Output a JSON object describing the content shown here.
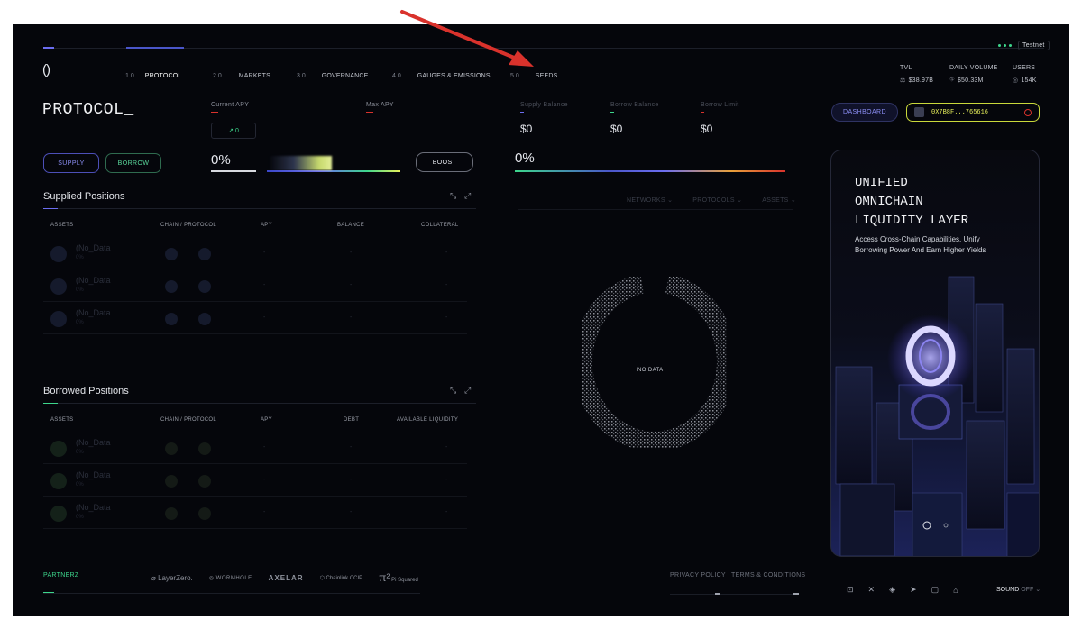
{
  "network_label": "Testnet",
  "nav": [
    {
      "num": "1.0",
      "label": "PROTOCOL"
    },
    {
      "num": "2.0",
      "label": "MARKETS"
    },
    {
      "num": "3.0",
      "label": "GOVERNANCE"
    },
    {
      "num": "4.0",
      "label": "GAUGES & EMISSIONS"
    },
    {
      "num": "5.0",
      "label": "SEEDS"
    }
  ],
  "stats": {
    "tvl_label": "TVL",
    "tvl_value": "$38.97B",
    "volume_label": "DAILY VOLUME",
    "volume_value": "$50.33M",
    "users_label": "USERS",
    "users_value": "154K"
  },
  "page_title": "PROTOCOL_",
  "apy": {
    "current_label": "Current APY",
    "max_label": "Max APY",
    "delta": "↗ 0",
    "current_pct": "0%",
    "boost_label": "BOOST"
  },
  "actions": {
    "supply": "SUPPLY",
    "borrow": "BORROW"
  },
  "balances": {
    "supply_label": "Supply Balance",
    "supply_value": "$0",
    "borrow_label": "Borrow Balance",
    "borrow_value": "$0",
    "limit_label": "Borrow Limit",
    "limit_value": "$0",
    "limit_pct": "0%"
  },
  "filters": {
    "networks": "NETWORKS",
    "protocols": "PROTOCOLS",
    "assets": "ASSETS"
  },
  "no_data": "NO DATA",
  "supplied": {
    "title": "Supplied Positions",
    "columns": [
      "ASSETS",
      "CHAIN / PROTOCOL",
      "APY",
      "BALANCE",
      "COLLATERAL"
    ],
    "rows": [
      {
        "name": "(No_Data",
        "cells": [
          "-",
          "-",
          "-"
        ]
      },
      {
        "name": "(No_Data",
        "cells": [
          "-",
          "-",
          "-"
        ]
      },
      {
        "name": "(No_Data",
        "cells": [
          "-",
          "-",
          "-"
        ]
      }
    ]
  },
  "borrowed": {
    "title": "Borrowed Positions",
    "columns": [
      "ASSETS",
      "CHAIN / PROTOCOL",
      "APY",
      "DEBT",
      "AVAILABLE LIQUIDITY"
    ],
    "rows": [
      {
        "name": "(No_Data",
        "cells": [
          "-",
          "-",
          "-"
        ]
      },
      {
        "name": "(No_Data",
        "cells": [
          "-",
          "-",
          "-"
        ]
      },
      {
        "name": "(No_Data",
        "cells": [
          "-",
          "-",
          "-"
        ]
      }
    ]
  },
  "wallet": {
    "dashboard_label": "DASHBOARD",
    "address": "0X7B8F...765616"
  },
  "promo": {
    "line1": "UNIFIED",
    "line2": "OMNICHAIN",
    "line3": "LIQUIDITY LAYER",
    "subtitle1": "Access Cross-Chain Capabilities, Unify",
    "subtitle2": "Borrowing Power And Earn Higher Yields"
  },
  "footer": {
    "partners_label": "PARTNERZ",
    "partners": [
      "LayerZero.",
      "WORMHOLE",
      "AXELAR",
      "Chainlink CCIP",
      "Pi Squared"
    ],
    "privacy": "PRIVACY POLICY",
    "terms": "TERMS & CONDITIONS",
    "sound_label": "SOUND",
    "sound_state": "OFF"
  },
  "colors": {
    "accent_yellow": "#e8f15a",
    "accent_purple": "#6b6df0",
    "accent_green": "#3dd68c",
    "annotation_arrow": "#d9322c"
  }
}
